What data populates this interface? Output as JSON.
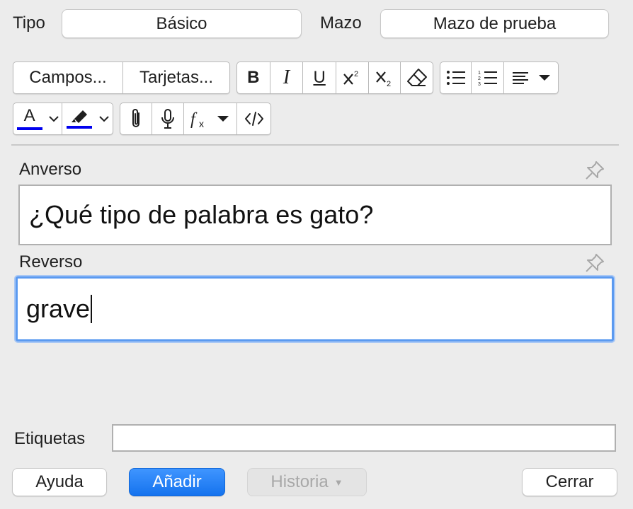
{
  "header": {
    "tipo_label": "Tipo",
    "tipo_value": "Básico",
    "mazo_label": "Mazo",
    "mazo_value": "Mazo de prueba"
  },
  "toolbar": {
    "campos_label": "Campos...",
    "tarjetas_label": "Tarjetas...",
    "bold_label": "B",
    "italic_label": "I",
    "underline_label": "U",
    "font_color_label": "A",
    "icons": [
      "superscript-icon",
      "subscript-icon",
      "eraser-icon",
      "bullet-list-icon",
      "numbered-list-icon",
      "align-icon",
      "highlighter-icon",
      "paperclip-icon",
      "microphone-icon",
      "function-icon",
      "code-icon"
    ],
    "font_color": "#0000ee",
    "highlight_color": "#0000ee"
  },
  "fields": [
    {
      "label": "Anverso",
      "value": "¿Qué tipo de palabra es gato?"
    },
    {
      "label": "Reverso",
      "value": "grave"
    }
  ],
  "tags": {
    "label": "Etiquetas",
    "value": ""
  },
  "footer": {
    "help_label": "Ayuda",
    "add_label": "Añadir",
    "history_label": "Historia",
    "close_label": "Cerrar"
  },
  "colors": {
    "accent": "#1a73ef",
    "focus_ring": "#5b9af0",
    "background": "#ececec"
  }
}
